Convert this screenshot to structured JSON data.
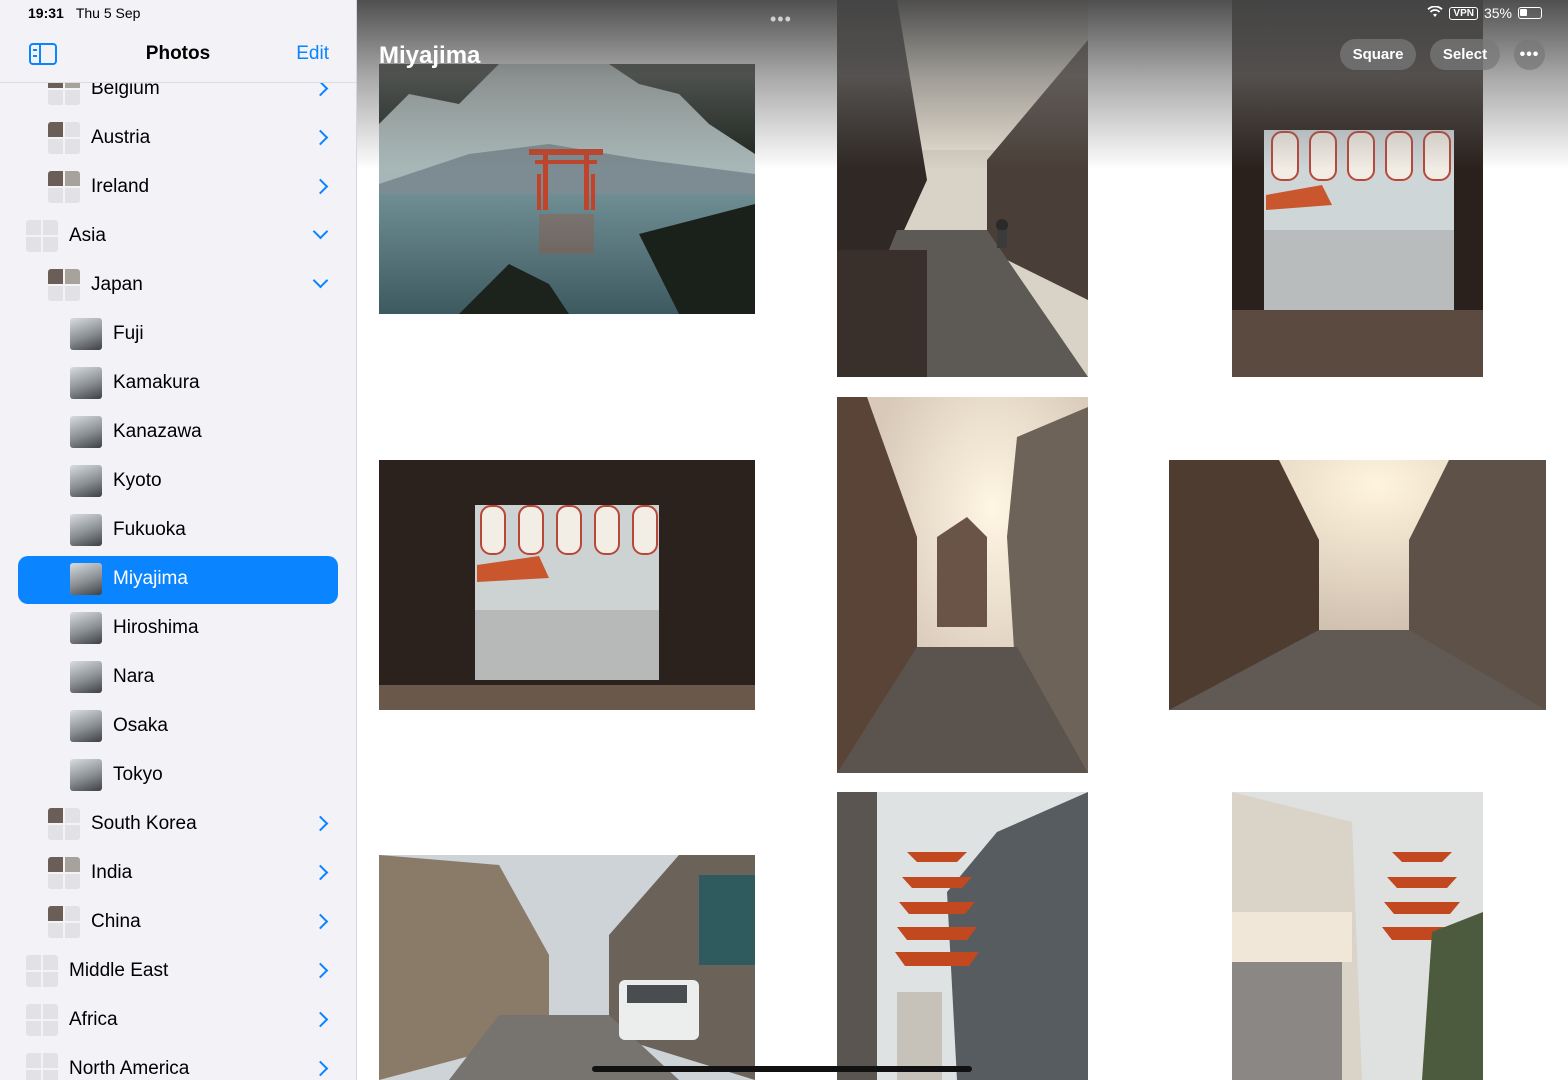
{
  "status_bar": {
    "time": "19:31",
    "date": "Thu 5 Sep",
    "vpn": "VPN",
    "battery": "35%",
    "battery_level": 0.35
  },
  "sidebar": {
    "title": "Photos",
    "edit_label": "Edit",
    "items": [
      {
        "label": "Belgium",
        "level": 1,
        "chevron": "right"
      },
      {
        "label": "Austria",
        "level": 1,
        "chevron": "right"
      },
      {
        "label": "Ireland",
        "level": 1,
        "chevron": "right"
      },
      {
        "label": "Asia",
        "level": 0,
        "chevron": "down"
      },
      {
        "label": "Japan",
        "level": 1,
        "chevron": "down"
      },
      {
        "label": "Fuji",
        "level": 2,
        "chevron": "none"
      },
      {
        "label": "Kamakura",
        "level": 2,
        "chevron": "none"
      },
      {
        "label": "Kanazawa",
        "level": 2,
        "chevron": "none"
      },
      {
        "label": "Kyoto",
        "level": 2,
        "chevron": "none"
      },
      {
        "label": "Fukuoka",
        "level": 2,
        "chevron": "none"
      },
      {
        "label": "Miyajima",
        "level": 2,
        "chevron": "none",
        "selected": true
      },
      {
        "label": "Hiroshima",
        "level": 2,
        "chevron": "none"
      },
      {
        "label": "Nara",
        "level": 2,
        "chevron": "none"
      },
      {
        "label": "Osaka",
        "level": 2,
        "chevron": "none"
      },
      {
        "label": "Tokyo",
        "level": 2,
        "chevron": "none"
      },
      {
        "label": "South Korea",
        "level": 1,
        "chevron": "right"
      },
      {
        "label": "India",
        "level": 1,
        "chevron": "right"
      },
      {
        "label": "China",
        "level": 1,
        "chevron": "right"
      },
      {
        "label": "Middle East",
        "level": 0,
        "chevron": "right"
      },
      {
        "label": "Africa",
        "level": 0,
        "chevron": "right"
      },
      {
        "label": "North America",
        "level": 0,
        "chevron": "right"
      }
    ]
  },
  "main": {
    "album_title": "Miyajima",
    "square_label": "Square",
    "select_label": "Select",
    "more_label": "•••",
    "top_dots": "•••"
  },
  "colors": {
    "accent": "#0a84ff",
    "sidebar_bg": "#f2f2f7"
  }
}
